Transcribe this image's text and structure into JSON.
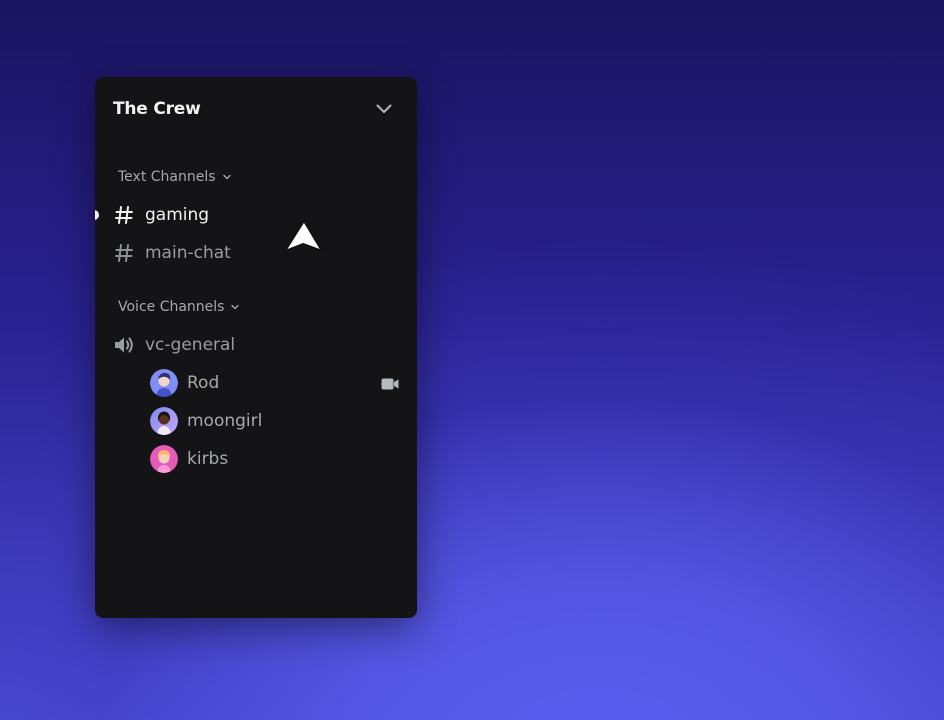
{
  "server": {
    "name": "The Crew"
  },
  "categories": [
    {
      "label": "Text Channels"
    },
    {
      "label": "Voice Channels"
    }
  ],
  "text_channels": [
    {
      "name": "gaming",
      "selected": true
    },
    {
      "name": "main-chat",
      "selected": false
    }
  ],
  "voice_channel": {
    "name": "vc-general",
    "users": [
      {
        "name": "Rod",
        "camera_on": true
      },
      {
        "name": "moongirl",
        "camera_on": false
      },
      {
        "name": "kirbs",
        "camera_on": false
      }
    ]
  },
  "colors": {
    "panel": "#141416",
    "text_primary": "#f2f3f5",
    "text_muted": "#9a9ca3",
    "background_top": "#1b1460",
    "background_glow": "#5b5ff0"
  }
}
